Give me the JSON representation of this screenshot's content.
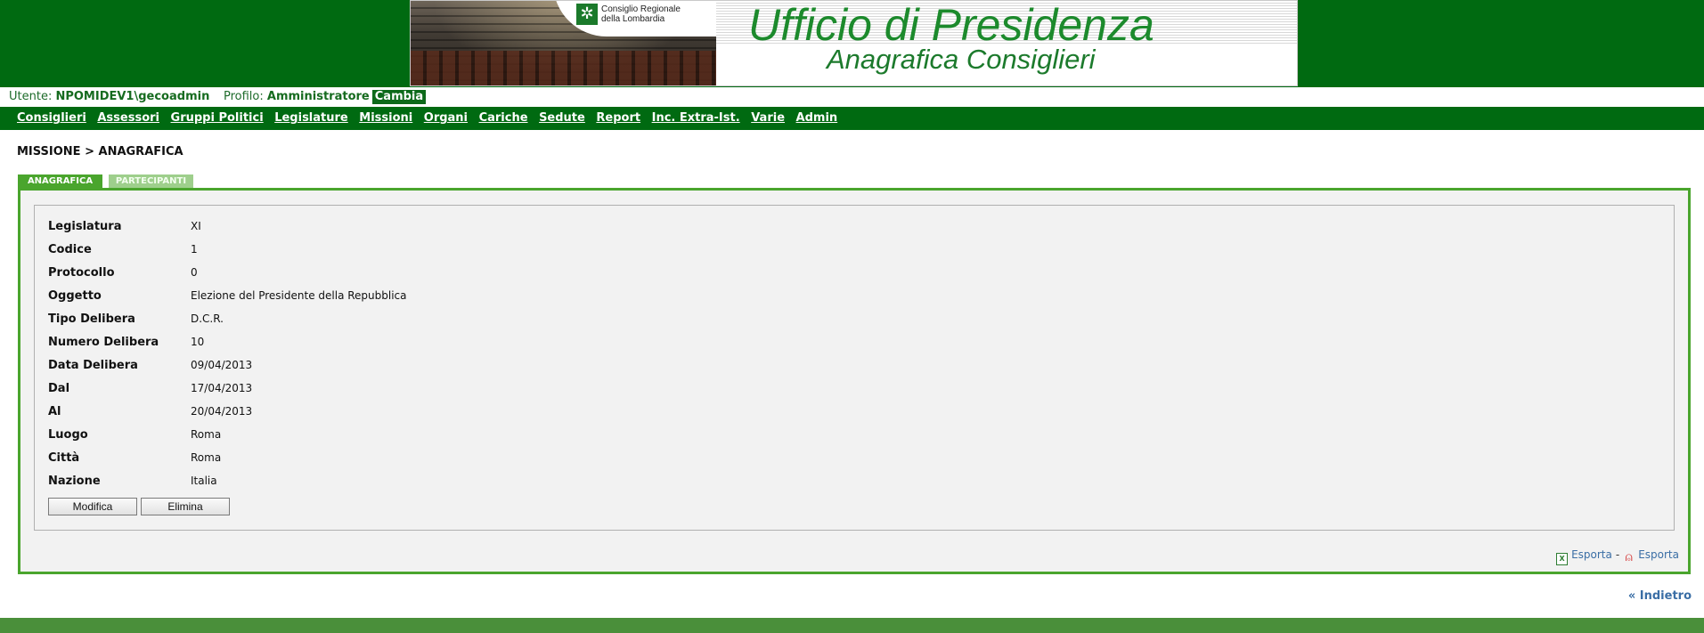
{
  "header": {
    "title": "Ufficio di Presidenza",
    "subtitle": "Anagrafica Consiglieri",
    "logo_text": [
      "Consiglio Regionale",
      "della Lombardia"
    ]
  },
  "userbar": {
    "user_label": "Utente:",
    "user_value": "NPOMIDEV1\\gecoadmin",
    "profile_label": "Profilo:",
    "profile_value": "Amministratore",
    "change_link": "Cambia"
  },
  "nav": {
    "items": [
      "Consiglieri",
      "Assessori",
      "Gruppi Politici",
      "Legislature",
      "Missioni",
      "Organi",
      "Cariche",
      "Sedute",
      "Report",
      "Inc. Extra-Ist.",
      "Varie",
      "Admin"
    ]
  },
  "breadcrumb": "MISSIONE > ANAGRAFICA",
  "tabs": [
    {
      "label": "ANAGRAFICA",
      "active": true
    },
    {
      "label": "PARTECIPANTI",
      "active": false
    }
  ],
  "details": [
    {
      "label": "Legislatura",
      "value": "XI"
    },
    {
      "label": "Codice",
      "value": "1"
    },
    {
      "label": "Protocollo",
      "value": "0"
    },
    {
      "label": "Oggetto",
      "value": "Elezione del Presidente della Repubblica"
    },
    {
      "label": "Tipo Delibera",
      "value": "D.C.R."
    },
    {
      "label": "Numero Delibera",
      "value": "10"
    },
    {
      "label": "Data Delibera",
      "value": "09/04/2013"
    },
    {
      "label": "Dal",
      "value": "17/04/2013"
    },
    {
      "label": "Al",
      "value": "20/04/2013"
    },
    {
      "label": "Luogo",
      "value": "Roma"
    },
    {
      "label": "Città",
      "value": "Roma"
    },
    {
      "label": "Nazione",
      "value": "Italia"
    }
  ],
  "buttons": {
    "edit": "Modifica",
    "delete": "Elimina"
  },
  "export": {
    "excel_label": "Esporta",
    "separator": "-",
    "pdf_label": "Esporta"
  },
  "back_link": "« Indietro",
  "colors": {
    "brand_green": "#006a11",
    "accent_green": "#4aa52d",
    "link_blue": "#3a6ea5"
  },
  "icons": [
    "excel-icon",
    "pdf-icon",
    "logo-icon"
  ]
}
